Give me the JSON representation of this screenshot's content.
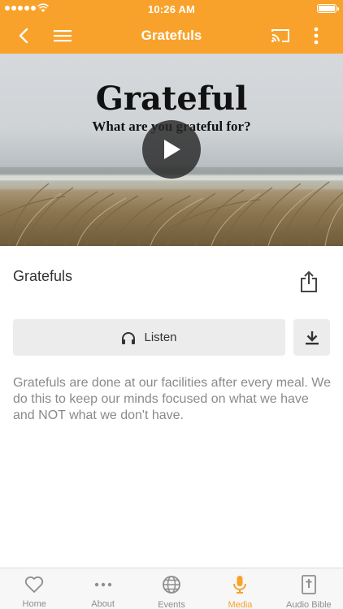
{
  "status_bar": {
    "time": "10:26 AM"
  },
  "nav": {
    "title": "Gratefuls"
  },
  "hero": {
    "title": "Grateful",
    "subtitle": "What are you grateful for?"
  },
  "media": {
    "title": "Gratefuls",
    "listen_label": "Listen",
    "description": "Gratefuls are done at our facilities after every meal. We do this to keep our minds focused on what we have and NOT what we don't have."
  },
  "colors": {
    "accent": "#f8a22b",
    "tab_inactive": "#8e8e8e",
    "button_bg": "#ececec"
  },
  "tabs": [
    {
      "label": "Home",
      "icon": "heart-icon",
      "active": false
    },
    {
      "label": "About",
      "icon": "dots-icon",
      "active": false
    },
    {
      "label": "Events",
      "icon": "globe-icon",
      "active": false
    },
    {
      "label": "Media",
      "icon": "microphone-icon",
      "active": true
    },
    {
      "label": "Audio Bible",
      "icon": "bible-icon",
      "active": false
    }
  ]
}
